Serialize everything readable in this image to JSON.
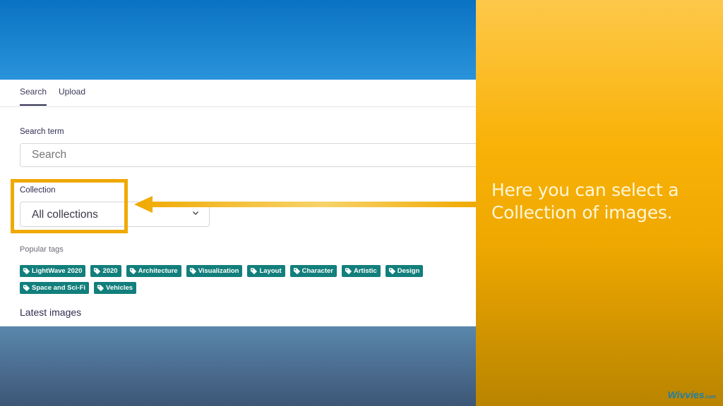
{
  "app": {
    "tabs": [
      {
        "label": "Search",
        "active": true
      },
      {
        "label": "Upload",
        "active": false
      }
    ]
  },
  "search": {
    "label": "Search term",
    "placeholder": "Search",
    "value": ""
  },
  "collection": {
    "label": "Collection",
    "selected": "All collections"
  },
  "popular_tags": {
    "label": "Popular tags",
    "tags": [
      "LightWave 2020",
      "2020",
      "Architecture",
      "Visualization",
      "Layout",
      "Character",
      "Artistic",
      "Design",
      "Space and Sci-Fi",
      "Vehicles"
    ]
  },
  "latest_images": {
    "heading": "Latest images"
  },
  "callout": {
    "text": "Here you can select a Collection of images."
  },
  "brand": {
    "name": "Wivvies",
    "suffix": ".com"
  },
  "colors": {
    "tag_bg": "#127f7c",
    "highlight": "#f0a900",
    "header_blue": "#0a72c2"
  }
}
